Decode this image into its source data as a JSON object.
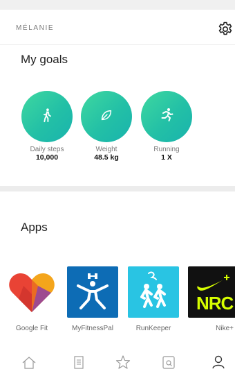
{
  "profile": {
    "username": "MÉLANIE"
  },
  "goals": {
    "title": "My goals",
    "items": [
      {
        "label": "Daily steps",
        "value": "10,000",
        "icon": "walking-person-icon"
      },
      {
        "label": "Weight",
        "value": "48.5 kg",
        "icon": "leaf-icon"
      },
      {
        "label": "Running",
        "value": "1 X",
        "icon": "running-person-icon"
      }
    ]
  },
  "apps": {
    "title": "Apps",
    "items": [
      {
        "name": "Google Fit",
        "icon": "google-fit-logo"
      },
      {
        "name": "MyFitnessPal",
        "icon": "myfitnesspal-logo"
      },
      {
        "name": "RunKeeper",
        "icon": "runkeeper-logo"
      },
      {
        "name": "Nike+",
        "icon": "nike-run-club-logo",
        "logo_text": "NRC"
      }
    ]
  },
  "tabbar": {
    "items": [
      {
        "name": "home",
        "icon": "home-icon"
      },
      {
        "name": "journal",
        "icon": "document-icon"
      },
      {
        "name": "favorites",
        "icon": "star-icon"
      },
      {
        "name": "discover",
        "icon": "search-device-icon"
      },
      {
        "name": "profile",
        "icon": "profile-icon",
        "active": true
      }
    ]
  },
  "colors": {
    "goal_gradient_start": "#3fd8a0",
    "goal_gradient_end": "#19b3ad",
    "myfitnesspal_blue": "#0d6cb5",
    "runkeeper_cyan": "#29c4e3",
    "nike_volt": "#d7ff00",
    "divider": "#ececec"
  }
}
